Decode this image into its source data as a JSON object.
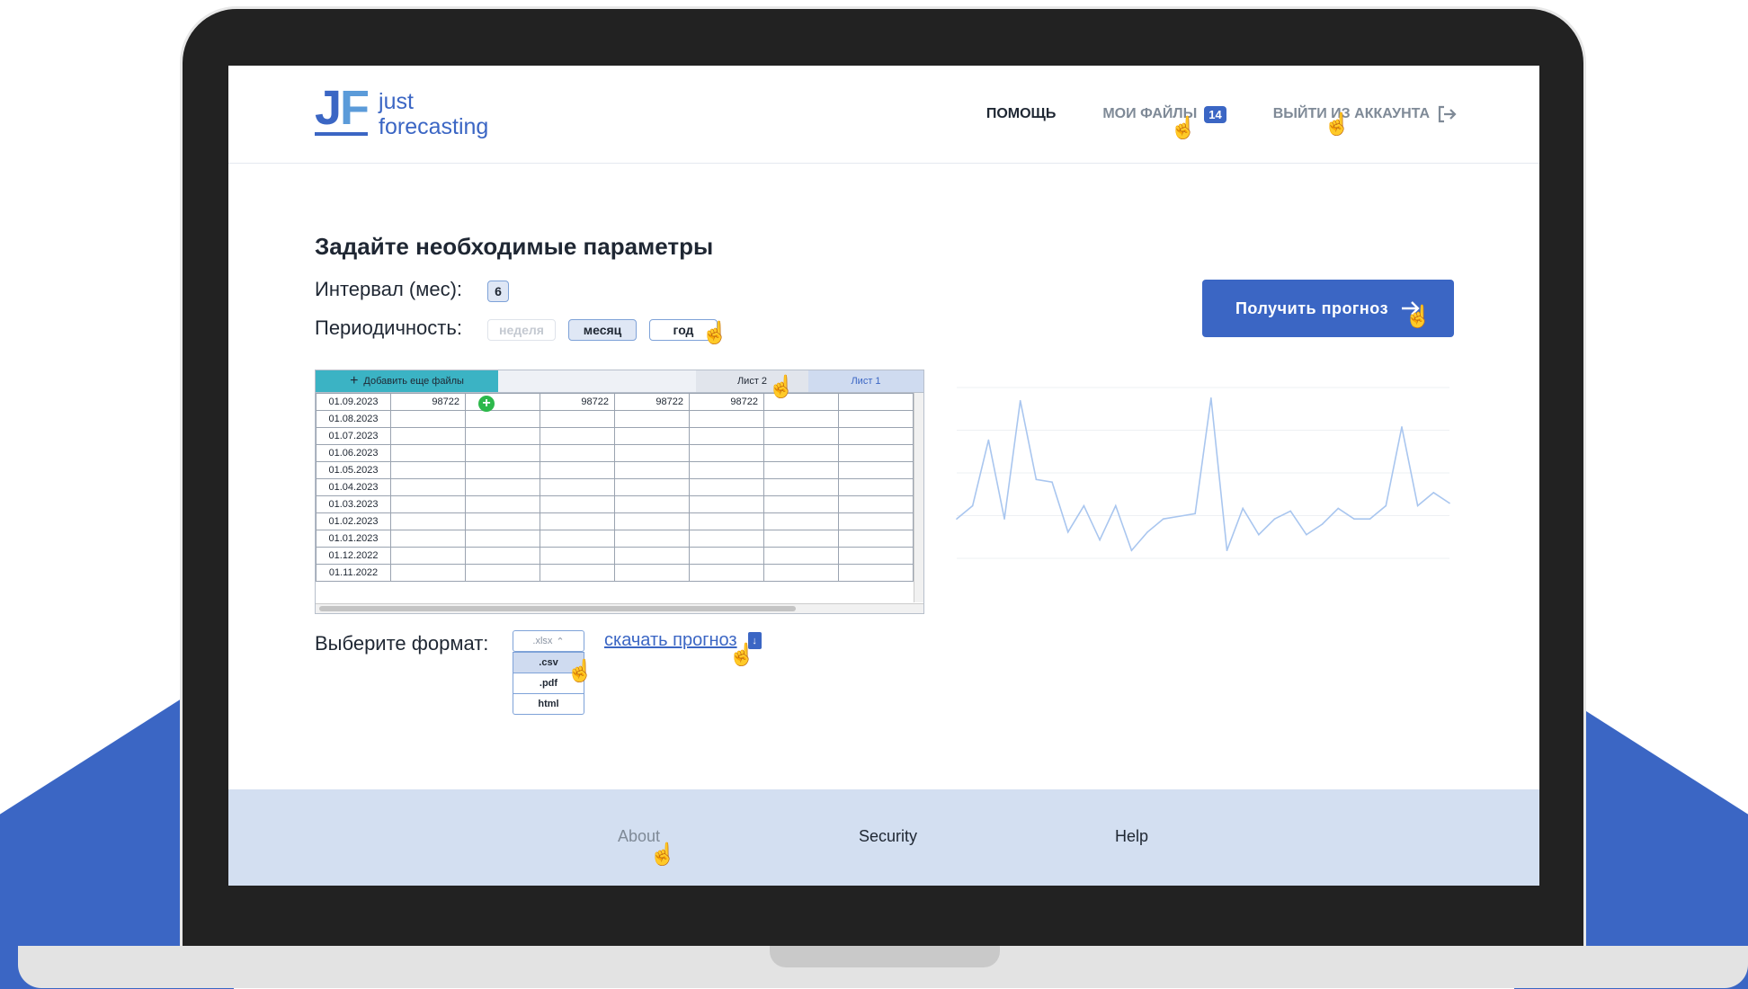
{
  "brand": {
    "mark_j": "J",
    "mark_f": "F",
    "line1": "just",
    "line2": "forecasting"
  },
  "nav": {
    "help": "ПОМОЩЬ",
    "files": "МОИ ФАЙЛЫ",
    "files_count": "14",
    "logout": "ВЫЙТИ ИЗ АККАУНТА"
  },
  "params": {
    "title": "Задайте необходимые параметры",
    "interval_label": "Интервал (мес):",
    "interval_value": "6",
    "period_label": "Периодичность:",
    "period_options": [
      "неделя",
      "месяц",
      "год"
    ],
    "period_selected": "месяц"
  },
  "forecast_button": "Получить прогноз",
  "sheet": {
    "add_files": "Добавить еще файлы",
    "tabs": [
      "Лист 2",
      "Лист 1"
    ],
    "active_tab": "Лист 1",
    "rows": [
      {
        "date": "01.09.2023",
        "c1": "98722",
        "c2": "",
        "c3": "98722",
        "c4": "98722",
        "c5": "98722"
      },
      {
        "date": "01.08.2023"
      },
      {
        "date": "01.07.2023"
      },
      {
        "date": "01.06.2023"
      },
      {
        "date": "01.05.2023"
      },
      {
        "date": "01.04.2023"
      },
      {
        "date": "01.03.2023"
      },
      {
        "date": "01.02.2023"
      },
      {
        "date": "01.01.2023"
      },
      {
        "date": "01.12.2022"
      },
      {
        "date": "01.11.2022"
      }
    ]
  },
  "chart_data": {
    "type": "line",
    "values": [
      30,
      35,
      60,
      30,
      75,
      45,
      44,
      25,
      35,
      22,
      35,
      18,
      25,
      30,
      31,
      32,
      76,
      18,
      34,
      24,
      30,
      33,
      24,
      28,
      34,
      30,
      30,
      35,
      65,
      35,
      40,
      36
    ],
    "ylim": [
      15,
      80
    ],
    "color": "#a9c6ef"
  },
  "format": {
    "label": "Выберите формат:",
    "selected": ".xlsx",
    "options": [
      ".csv",
      ".pdf",
      "html"
    ],
    "highlighted": ".csv",
    "download": "скачать прогноз"
  },
  "footer": {
    "about": "About",
    "security": "Security",
    "help": "Help"
  },
  "colors": {
    "primary": "#3b66c4",
    "teal": "#3bb3c4",
    "green": "#2db84b",
    "footer_bg": "#d3dff1"
  }
}
